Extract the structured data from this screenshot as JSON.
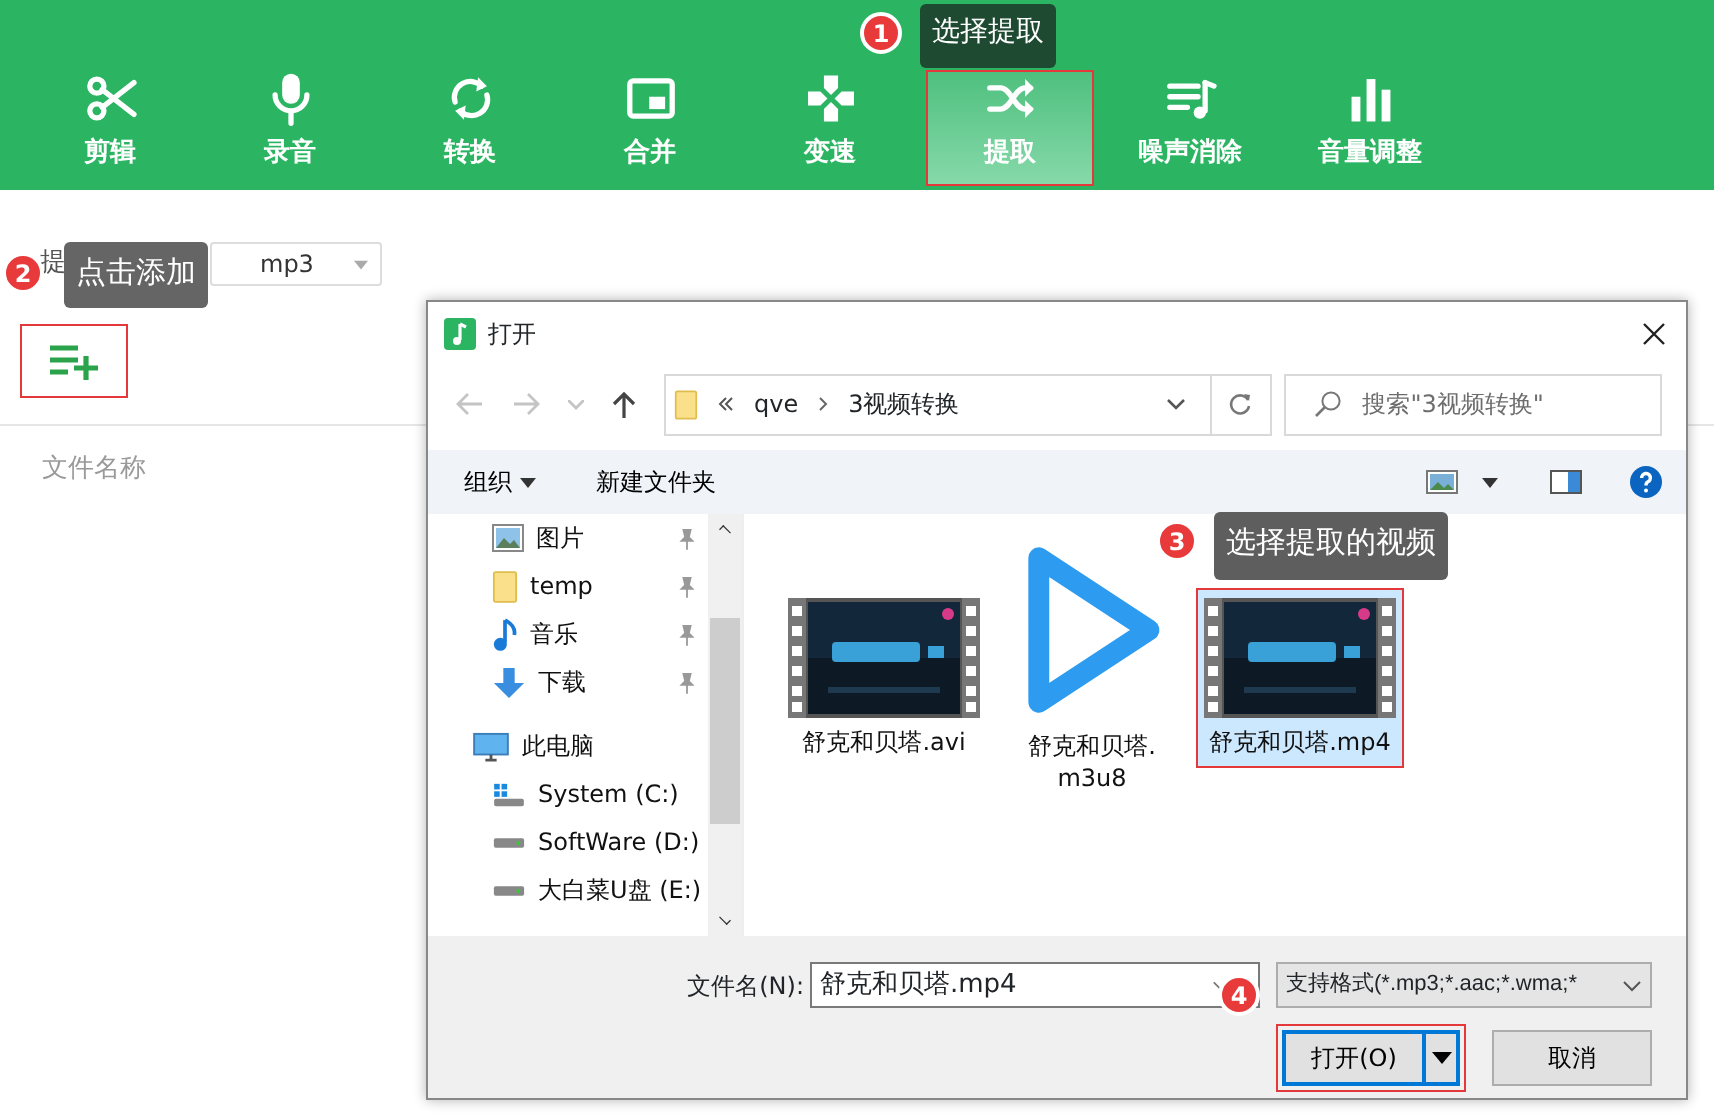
{
  "toolbar": {
    "tools": [
      {
        "label": "剪辑",
        "selected": false
      },
      {
        "label": "录音",
        "selected": false
      },
      {
        "label": "转换",
        "selected": false
      },
      {
        "label": "合并",
        "selected": false
      },
      {
        "label": "变速",
        "selected": false
      },
      {
        "label": "提取",
        "selected": true,
        "highlighted": true
      },
      {
        "label": "噪声消除",
        "selected": false
      },
      {
        "label": "音量调整",
        "selected": false
      }
    ]
  },
  "format": {
    "label": "提",
    "value": "mp3"
  },
  "add_button": {
    "highlighted": true
  },
  "file_list": {
    "column": "文件名称"
  },
  "dialog": {
    "title": "打开",
    "address": [
      "qve",
      "3视频转换"
    ],
    "search_placeholder": "搜索\"3视频转换\"",
    "organize": "组织",
    "new_folder": "新建文件夹",
    "nav": [
      {
        "label": "图片",
        "pinned": true,
        "selected": false
      },
      {
        "label": "temp",
        "pinned": true,
        "selected": false
      },
      {
        "label": "音乐",
        "pinned": true,
        "selected": false
      },
      {
        "label": "下载",
        "pinned": true,
        "selected": false
      },
      {
        "label": "此电脑",
        "selected": false,
        "children": [
          {
            "label": "System (C:)",
            "selected": false
          },
          {
            "label": "SoftWare (D:)",
            "selected": false
          },
          {
            "label": "大白菜U盘 (E:)",
            "selected": false
          }
        ]
      }
    ],
    "files": [
      {
        "name": "舒克和贝塔.avi",
        "kind": "video",
        "selected": false,
        "highlighted": false
      },
      {
        "name": "舒克和贝塔.m3u8",
        "kind": "playlist",
        "selected": false,
        "highlighted": false
      },
      {
        "name": "舒克和贝塔.mp4",
        "kind": "video",
        "selected": true,
        "highlighted": true
      }
    ],
    "filename_label": "文件名(N):",
    "filename": "舒克和贝塔.mp4",
    "filter": "支持格式(*.mp3;*.aac;*.wma;*",
    "open_button": {
      "label": "打开(O)",
      "highlighted": true
    },
    "cancel_button": "取消"
  },
  "annotations": [
    {
      "number": "1",
      "text": "选择提取"
    },
    {
      "number": "2",
      "text": "点击添加"
    },
    {
      "number": "3",
      "text": "选择提取的视频"
    },
    {
      "number": "4"
    }
  ]
}
